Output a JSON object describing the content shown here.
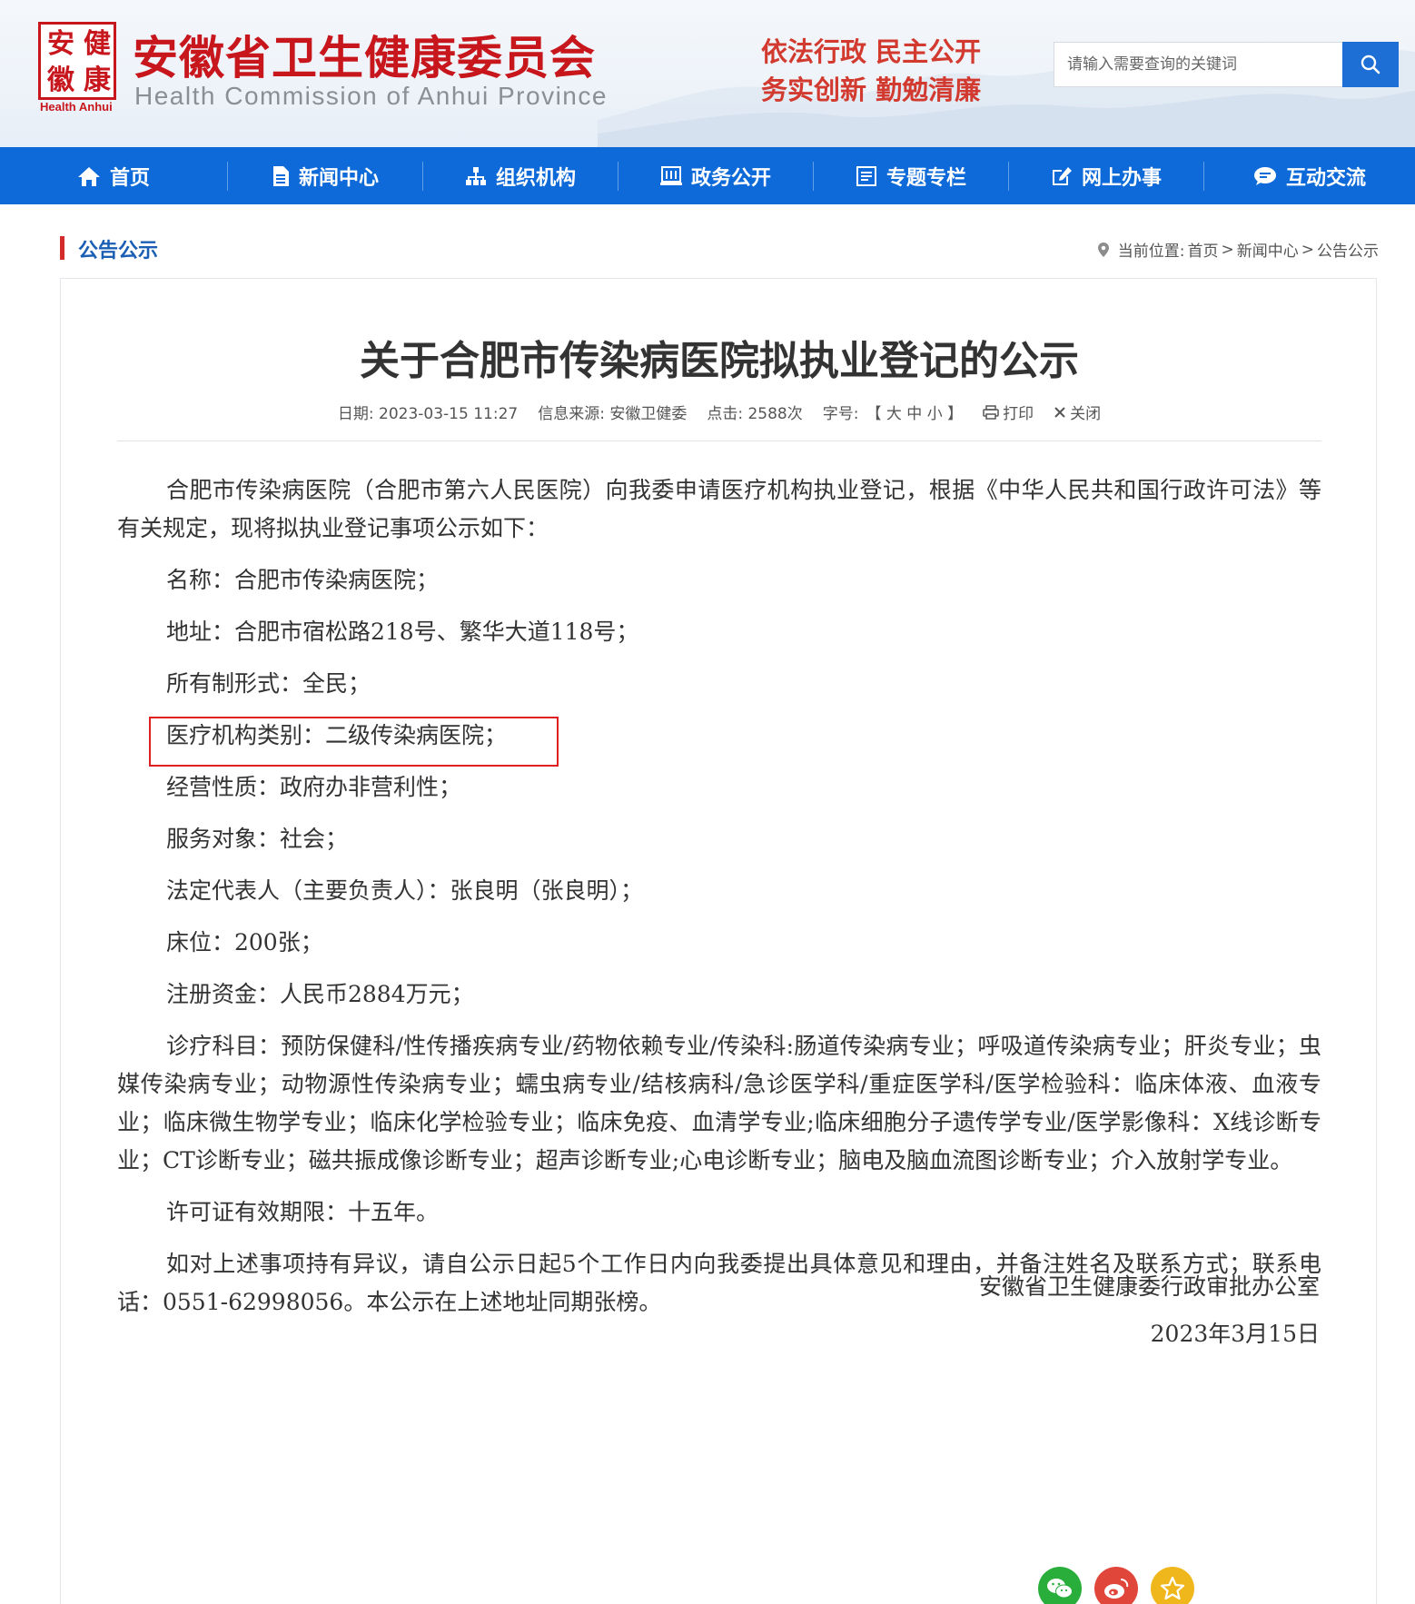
{
  "header": {
    "seal_chars": [
      "安",
      "健",
      "徽",
      "康"
    ],
    "seal_caption": "Health Anhui",
    "site_title": "安徽省卫生健康委员会",
    "site_subtitle": "Health Commission of Anhui Province",
    "motto_line1": "依法行政  民主公开",
    "motto_line2": "务实创新  勤勉清廉",
    "search_placeholder": "请输入需要查询的关键词"
  },
  "nav": {
    "items": [
      {
        "label": "首页",
        "icon": "home-icon"
      },
      {
        "label": "新闻中心",
        "icon": "document-icon"
      },
      {
        "label": "组织机构",
        "icon": "org-chart-icon"
      },
      {
        "label": "政务公开",
        "icon": "building-icon"
      },
      {
        "label": "专题专栏",
        "icon": "list-icon"
      },
      {
        "label": "网上办事",
        "icon": "edit-icon"
      },
      {
        "label": "互动交流",
        "icon": "chat-icon"
      }
    ]
  },
  "location": {
    "section_title": "公告公示",
    "prefix": "当前位置:",
    "crumbs": [
      "首页",
      "新闻中心",
      "公告公示"
    ],
    "separator": ">"
  },
  "article": {
    "title": "关于合肥市传染病医院拟执业登记的公示",
    "meta": {
      "date": "日期: 2023-03-15 11:27",
      "source": "信息来源: 安徽卫健委",
      "clicks": "点击: 2588次",
      "font_label": "字号:",
      "font_sizes": "【 大 中 小 】",
      "print": "打印",
      "close": "关闭"
    },
    "paragraphs": [
      "合肥市传染病医院（合肥市第六人民医院）向我委申请医疗机构执业登记，根据《中华人民共和国行政许可法》等有关规定，现将拟执业登记事项公示如下：",
      "名称：合肥市传染病医院；",
      "地址：合肥市宿松路218号、繁华大道118号；",
      "所有制形式：全民；",
      "医疗机构类别：二级传染病医院；",
      "经营性质：政府办非营利性；",
      "服务对象：社会；",
      "法定代表人（主要负责人）：张良明（张良明）；",
      "床位：200张；",
      "注册资金：人民币2884万元；",
      "诊疗科目：预防保健科/性传播疾病专业/药物依赖专业/传染科:肠道传染病专业；呼吸道传染病专业；肝炎专业；虫媒传染病专业；动物源性传染病专业；蠕虫病专业/结核病科/急诊医学科/重症医学科/医学检验科：临床体液、血液专业；临床微生物学专业；临床化学检验专业；临床免疫、血清学专业;临床细胞分子遗传学专业/医学影像科：X线诊断专业；CT诊断专业；磁共振成像诊断专业；超声诊断专业;心电诊断专业；脑电及脑血流图诊断专业；介入放射学专业。",
      "许可证有效期限：十五年。",
      "如对上述事项持有异议，请自公示日起5个工作日内向我委提出具体意见和理由，并备注姓名及联系方式；联系电话：0551-62998056。本公示在上述地址同期张榜。"
    ],
    "signature_org": "安徽省卫生健康委行政审批办公室",
    "signature_date": "2023年3月15日"
  },
  "share": [
    {
      "name": "wechat-share",
      "color": "#2aae3b"
    },
    {
      "name": "weibo-share",
      "color": "#e0463a"
    },
    {
      "name": "favorite-share",
      "color": "#f0b71c"
    }
  ]
}
